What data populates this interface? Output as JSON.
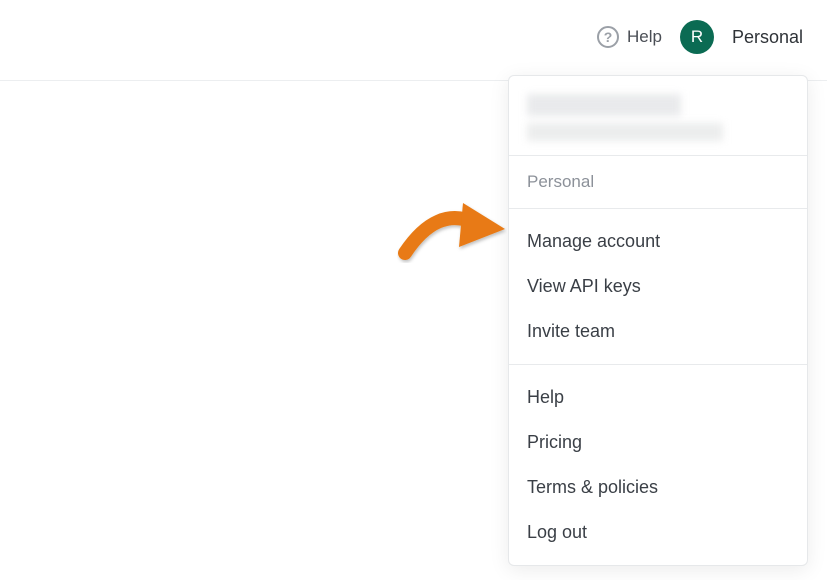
{
  "header": {
    "help_label": "Help",
    "avatar_initial": "R",
    "account_name": "Personal"
  },
  "dropdown": {
    "section_label": "Personal",
    "group_account": {
      "manage_account": "Manage account",
      "view_api_keys": "View API keys",
      "invite_team": "Invite team"
    },
    "group_misc": {
      "help": "Help",
      "pricing": "Pricing",
      "terms": "Terms & policies",
      "logout": "Log out"
    }
  }
}
